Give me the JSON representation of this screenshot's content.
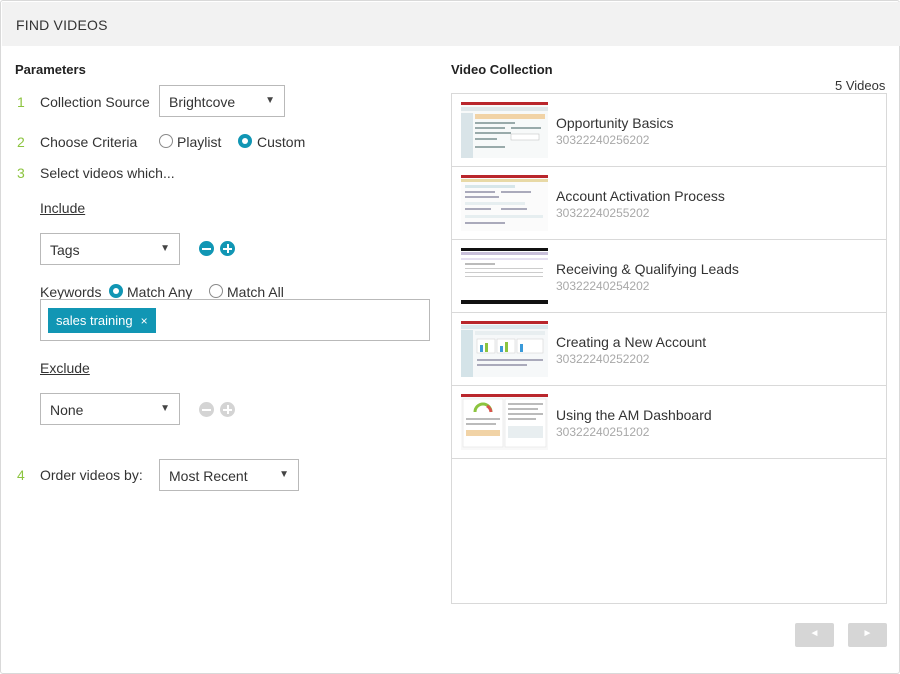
{
  "header": {
    "title": "FIND VIDEOS"
  },
  "params": {
    "title": "Parameters",
    "step1": {
      "num": "1",
      "label": "Collection Source",
      "value": "Brightcove"
    },
    "step2": {
      "num": "2",
      "label": "Choose Criteria",
      "option_playlist": "Playlist",
      "option_custom": "Custom",
      "selected": "Custom"
    },
    "step3": {
      "num": "3",
      "label": "Select videos which..."
    },
    "include": {
      "label": "Include",
      "select_value": "Tags",
      "keywords_label": "Keywords",
      "match_any": "Match Any",
      "match_all": "Match All",
      "selected_match": "Match Any",
      "tags": [
        {
          "text": "sales training",
          "remove": "×"
        }
      ]
    },
    "exclude": {
      "label": "Exclude",
      "select_value": "None"
    },
    "step4": {
      "num": "4",
      "label": "Order videos by:",
      "value": "Most Recent"
    }
  },
  "collection": {
    "title": "Video Collection",
    "count": "5 Videos",
    "videos": [
      {
        "title": "Opportunity Basics",
        "id": "30322240256202"
      },
      {
        "title": "Account Activation Process",
        "id": "30322240255202"
      },
      {
        "title": "Receiving & Qualifying Leads",
        "id": "30322240254202"
      },
      {
        "title": "Creating a New Account",
        "id": "30322240252202"
      },
      {
        "title": "Using the AM Dashboard",
        "id": "30322240251202"
      }
    ]
  },
  "pager": {
    "prev": "◄",
    "next": "►"
  },
  "colors": {
    "accent": "#1196b4",
    "step_number": "#8cc43f",
    "disabled": "#d4d4d4"
  },
  "icons": {
    "select": "caret-down-icon",
    "remove": "minus-circle-icon",
    "add": "plus-circle-icon"
  }
}
